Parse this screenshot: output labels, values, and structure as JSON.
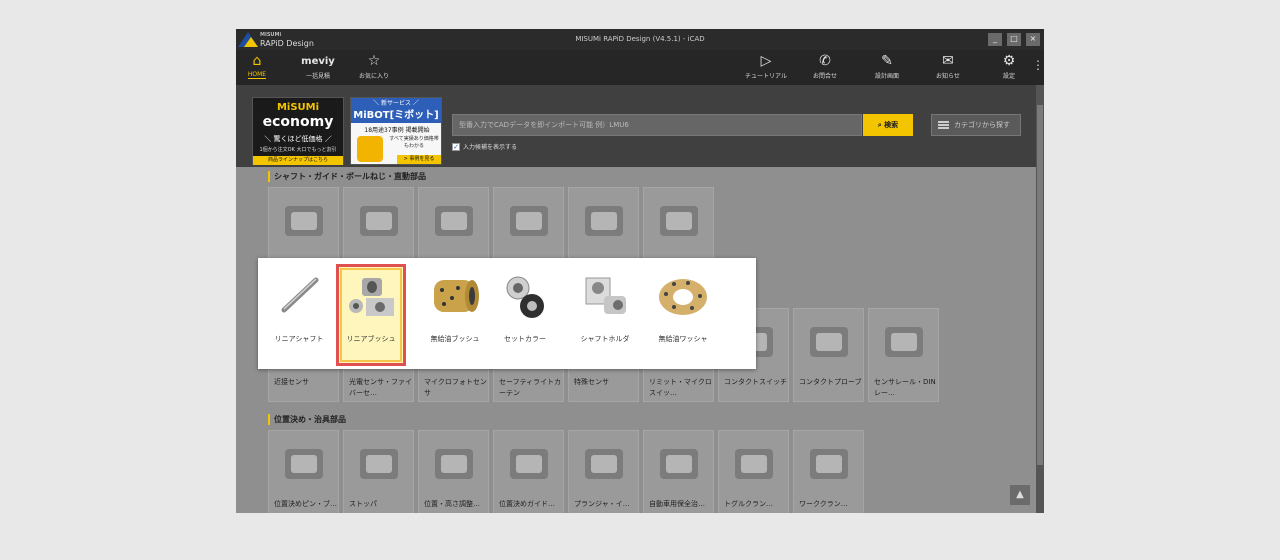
{
  "window": {
    "brand_top": "MISUMi",
    "brand_bottom": "RAPiD Design",
    "title": "MISUMi RAPiD Design (V4.5.1) - iCAD",
    "minimize": "_",
    "maximize": "□",
    "close": "×"
  },
  "toolbar": {
    "left": [
      {
        "label": "HOME",
        "icon": "⌂"
      },
      {
        "label": "一括見積",
        "icon": "meviy"
      },
      {
        "label": "お気に入り",
        "icon": "☆"
      }
    ],
    "right": [
      {
        "label": "チュートリアル",
        "icon": "▷"
      },
      {
        "label": "お問合せ",
        "icon": "✆"
      },
      {
        "label": "設計画面",
        "icon": "✎"
      },
      {
        "label": "お知らせ",
        "icon": "✉"
      },
      {
        "label": "設定",
        "icon": "⚙"
      }
    ],
    "more": "⋮"
  },
  "banners": {
    "economy": {
      "brand": "MiSUMi",
      "name": "economy",
      "tagline": "＼ 驚くほど低価格 ／",
      "note": "1個から注文OK  大口でもっと割引",
      "link": "商品ラインナップはこちら"
    },
    "mibot": {
      "header": "＼ 新サービス ／",
      "name": "MiBOT[ミボット]",
      "line1": "18用途37事例 掲載開始",
      "line2": "すべて実績あり価格帯もわかる",
      "link": "> 事例を見る"
    }
  },
  "search": {
    "placeholder": "型番入力でCADデータを即インポート可能  例）LMU6",
    "button": "検索",
    "category_button": "カテゴリから探す",
    "checkbox_label": "入力候補を表示する",
    "checkbox_checked": true
  },
  "sections": [
    {
      "title": "シャフト・ガイド・ボールねじ・直動部品"
    },
    {
      "title": "位置決め・治具部品"
    }
  ],
  "row1_cards": [],
  "row2_cards": [
    {
      "label": "近接センサ"
    },
    {
      "label": "光電センサ・ファイバーセ…"
    },
    {
      "label": "マイクロフォトセンサ"
    },
    {
      "label": "セーフティライトカーテン"
    },
    {
      "label": "特殊センサ"
    },
    {
      "label": "リミット・マイクロスイッ…"
    },
    {
      "label": "コンタクトスイッチ"
    },
    {
      "label": "コンタクトプローブ"
    },
    {
      "label": "センサレール・DINレー…"
    }
  ],
  "row3_cards": [
    {
      "label": "位置決めピン・ブ…"
    },
    {
      "label": "ストッパ"
    },
    {
      "label": "位置・高さ調整…"
    },
    {
      "label": "位置決めガイド…"
    },
    {
      "label": "プランジャ・イ…"
    },
    {
      "label": "自動車用保全治…"
    },
    {
      "label": "トグルクラン…"
    },
    {
      "label": "ワーククラン…"
    }
  ],
  "popup_items": [
    {
      "label": "リニアシャフト"
    },
    {
      "label": "リニアブッシュ"
    },
    {
      "label": "無給油ブッシュ"
    },
    {
      "label": "セットカラー"
    },
    {
      "label": "シャフトホルダ"
    },
    {
      "label": "無給油ワッシャ"
    }
  ],
  "scroll_top": "▲",
  "colors": {
    "accent": "#f3c400",
    "selection_border": "#e05050",
    "selection_fill": "#fff6bd"
  }
}
